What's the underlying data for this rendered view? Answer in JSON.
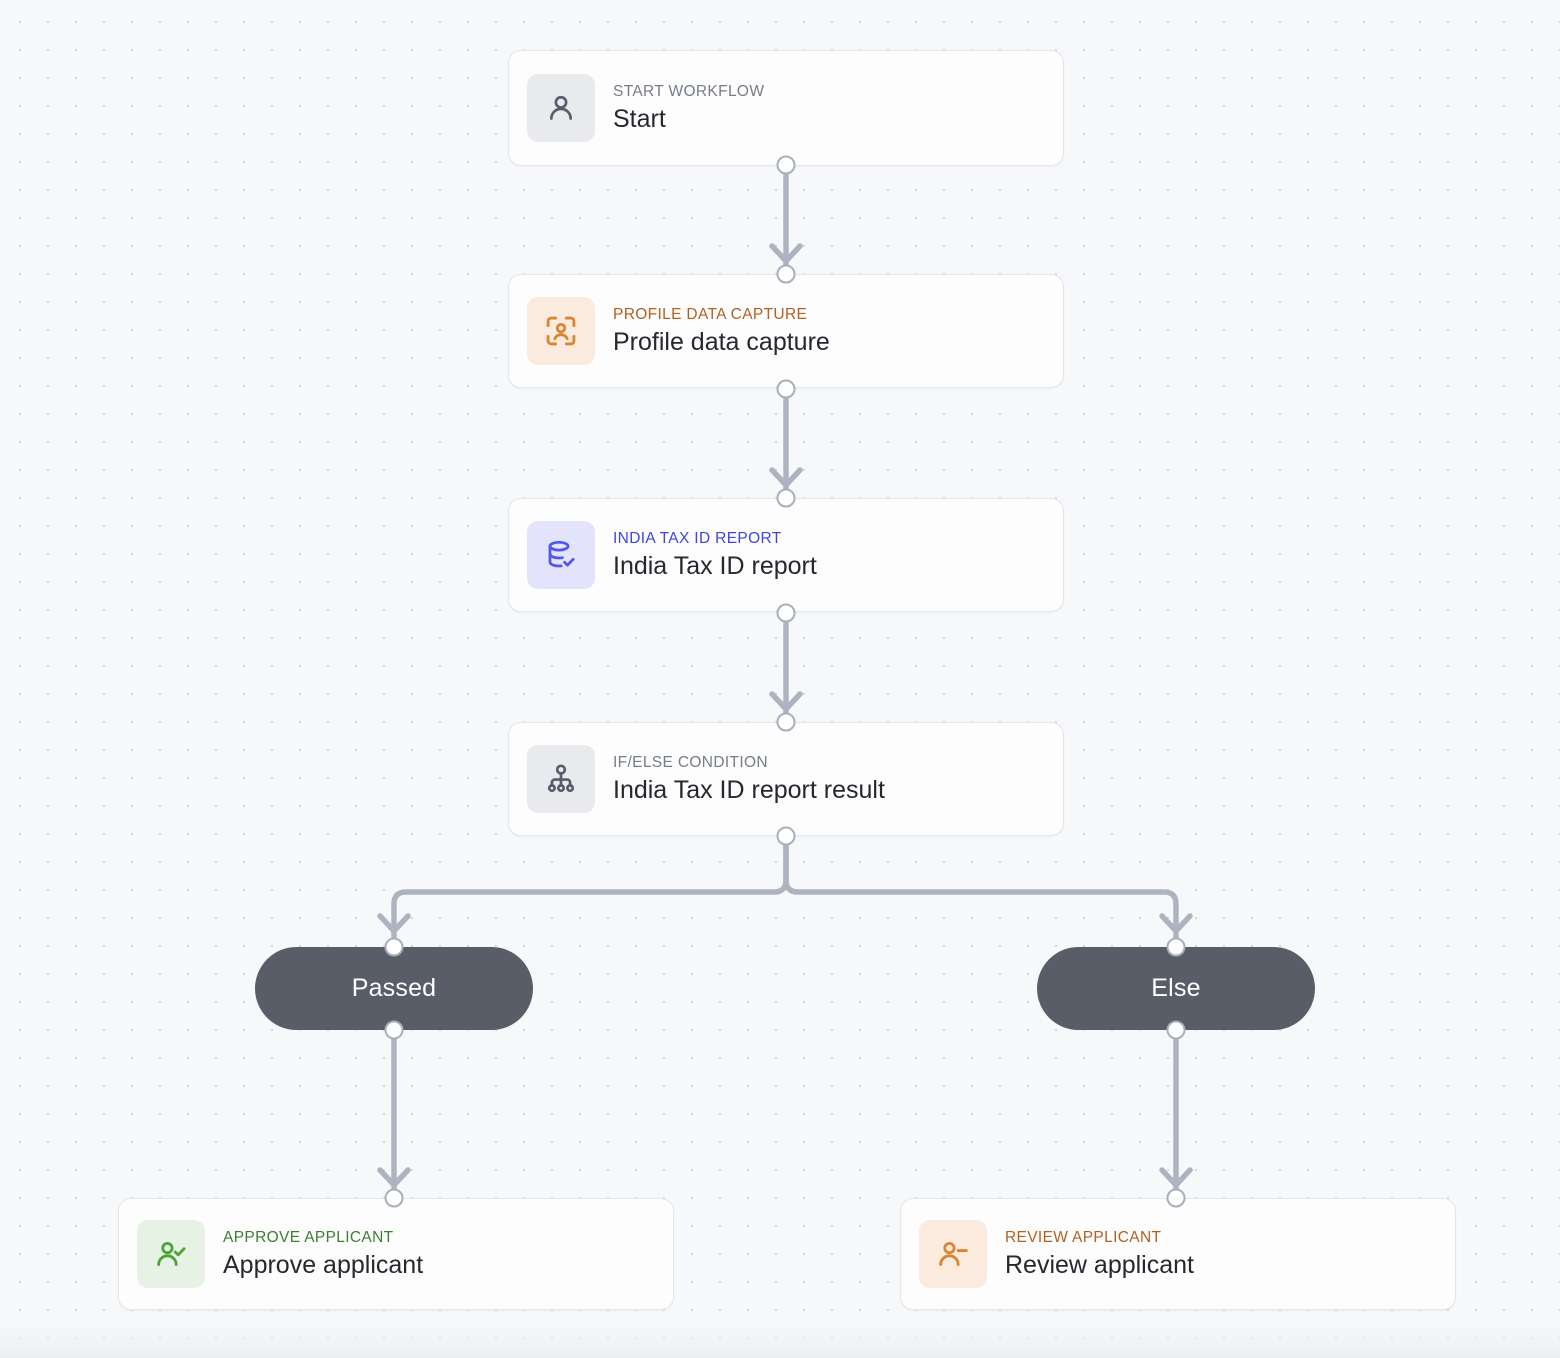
{
  "canvas": {
    "background_color": "#f7f8fa",
    "dot_color": "#d2d7e0",
    "edge_color": "#aeb4bf"
  },
  "theme_colors": {
    "gray_tile": "#e8eaee",
    "gray_text": "#767c88",
    "orange_tile": "#fbeade",
    "orange_text": "#b3601f",
    "orange_icon": "#d9862f",
    "indigo_tile": "#e3e4fb",
    "indigo_text": "#3f45e0",
    "indigo_icon": "#5257e8",
    "green_tile": "#e6f2e4",
    "green_text": "#3a7e2f",
    "green_icon": "#4ba33a",
    "pill_fill": "#595d68",
    "pill_text": "#ffffff",
    "title_text": "#25282e"
  },
  "nodes": [
    {
      "id": "start",
      "eyebrow": "START WORKFLOW",
      "title": "Start",
      "icon": "person-icon",
      "theme": "gray"
    },
    {
      "id": "profile_data_capture",
      "eyebrow": "PROFILE DATA CAPTURE",
      "title": "Profile data capture",
      "icon": "person-scan-icon",
      "theme": "orange"
    },
    {
      "id": "india_tax_id_report",
      "eyebrow": "INDIA TAX ID REPORT",
      "title": "India Tax ID report",
      "icon": "database-check-icon",
      "theme": "indigo"
    },
    {
      "id": "if_else_condition",
      "eyebrow": "IF/ELSE CONDITION",
      "title": "India Tax ID report result",
      "icon": "branch-hierarchy-icon",
      "theme": "gray"
    },
    {
      "id": "approve_applicant",
      "eyebrow": "APPROVE APPLICANT",
      "title": "Approve applicant",
      "icon": "person-check-icon",
      "theme": "green"
    },
    {
      "id": "review_applicant",
      "eyebrow": "REVIEW APPLICANT",
      "title": "Review applicant",
      "icon": "person-minus-icon",
      "theme": "orange"
    }
  ],
  "branches": [
    {
      "id": "passed",
      "label": "Passed"
    },
    {
      "id": "else",
      "label": "Else"
    }
  ]
}
